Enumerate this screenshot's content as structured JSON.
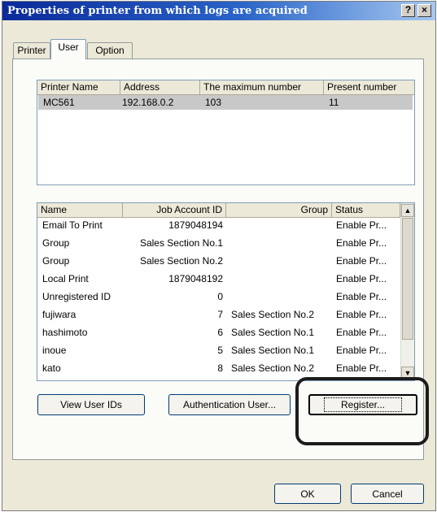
{
  "window": {
    "title": "Properties of printer from which logs are acquired",
    "help_glyph": "?",
    "close_glyph": "×"
  },
  "tabs": [
    "Printer",
    "User",
    "Option"
  ],
  "printer_list": {
    "columns": [
      "Printer Name",
      "Address",
      "The maximum number",
      "Present number"
    ],
    "rows": [
      [
        "MC561",
        "192.168.0.2",
        "103",
        "11"
      ]
    ]
  },
  "user_list": {
    "columns": [
      "Name",
      "Job Account ID",
      "Group",
      "Status"
    ],
    "rows": [
      [
        "Email To Print",
        "1879048194",
        "",
        "Enable Pr..."
      ],
      [
        "Group",
        "Sales Section No.1",
        "",
        "Enable Pr..."
      ],
      [
        "Group",
        "Sales Section No.2",
        "",
        "Enable Pr..."
      ],
      [
        "Local Print",
        "1879048192",
        "",
        "Enable Pr..."
      ],
      [
        "Unregistered ID",
        "0",
        "",
        "Enable Pr..."
      ],
      [
        "fujiwara",
        "7",
        "Sales Section No.2",
        "Enable Pr..."
      ],
      [
        "hashimoto",
        "6",
        "Sales Section No.1",
        "Enable Pr..."
      ],
      [
        "inoue",
        "5",
        "Sales Section No.1",
        "Enable Pr..."
      ],
      [
        "kato",
        "8",
        "Sales Section No.2",
        "Enable Pr..."
      ]
    ]
  },
  "buttons": {
    "view_user_ids": "View User IDs",
    "authentication_user": "Authentication User...",
    "register": "Register...",
    "ok": "OK",
    "cancel": "Cancel"
  },
  "icons": {
    "scroll_up": "scroll-up-arrow-icon",
    "scroll_down": "scroll-down-arrow-icon"
  },
  "colors": {
    "titlebar_start": "#0a2a9a",
    "titlebar_end": "#a6c8f0",
    "dialog_bg": "#ece9d8",
    "highlight_outline": "#1c1c1c"
  }
}
